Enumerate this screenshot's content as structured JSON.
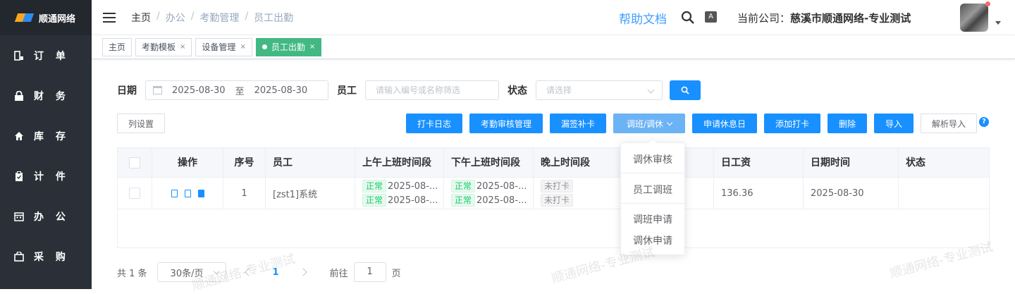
{
  "sidebar": {
    "logo_text": "顺通网络",
    "items": [
      {
        "label": "订 单",
        "icon": "order-icon"
      },
      {
        "label": "财 务",
        "icon": "lock-icon"
      },
      {
        "label": "库 存",
        "icon": "home-icon"
      },
      {
        "label": "计 件",
        "icon": "clipboard-icon"
      },
      {
        "label": "办 公",
        "icon": "calendar-icon"
      },
      {
        "label": "采 购",
        "icon": "shopping-icon"
      }
    ]
  },
  "header": {
    "breadcrumb": [
      "主页",
      "办公",
      "考勤管理",
      "员工出勤"
    ],
    "help": "帮助文档",
    "company_label": "当前公司：",
    "company_name": "慈溪市顺通网络-专业测试"
  },
  "tags": [
    {
      "label": "主页",
      "closable": false,
      "active": false
    },
    {
      "label": "考勤模板",
      "closable": true,
      "active": false
    },
    {
      "label": "设备管理",
      "closable": true,
      "active": false
    },
    {
      "label": "员工出勤",
      "closable": true,
      "active": true
    }
  ],
  "filter": {
    "date_label": "日期",
    "date_start": "2025-08-30",
    "date_sep": "至",
    "date_end": "2025-08-30",
    "employee_label": "员工",
    "employee_placeholder": "请输入编号或名称筛选",
    "status_label": "状态",
    "status_placeholder": "请选择"
  },
  "toolbar": {
    "column_settings": "列设置",
    "buttons": [
      "打卡日志",
      "考勤审核管理",
      "漏签补卡",
      "调班/调休",
      "申请休息日",
      "添加打卡",
      "删除",
      "导入"
    ],
    "parse_import": "解析导入",
    "help": "?"
  },
  "table": {
    "headers": [
      "操作",
      "序号",
      "员工",
      "上午上班时间段",
      "下午上班时间段",
      "晚上时间段",
      "日工资",
      "日期时间",
      "状态"
    ],
    "rows": [
      {
        "index": "1",
        "employee": "[zst1]系统",
        "morning": [
          {
            "status": "正常",
            "time": "2025-08-..."
          },
          {
            "status": "正常",
            "time": "2025-08-..."
          }
        ],
        "afternoon": [
          {
            "status": "正常",
            "time": "2025-08-..."
          },
          {
            "status": "正常",
            "time": "2025-08-..."
          }
        ],
        "evening": [
          "未打卡",
          "未打卡"
        ],
        "wage": "136.36",
        "date": "2025-08-30",
        "state": ""
      }
    ]
  },
  "dropdown": {
    "items": [
      "调休审核",
      "员工调班",
      "调班申请",
      "调休申请"
    ]
  },
  "pager": {
    "total": "共 1 条",
    "page_size": "30条/页",
    "current": "1",
    "goto_label": "前往",
    "goto_value": "1",
    "page_suffix": "页"
  },
  "watermark": "顺通网络-专业测试"
}
